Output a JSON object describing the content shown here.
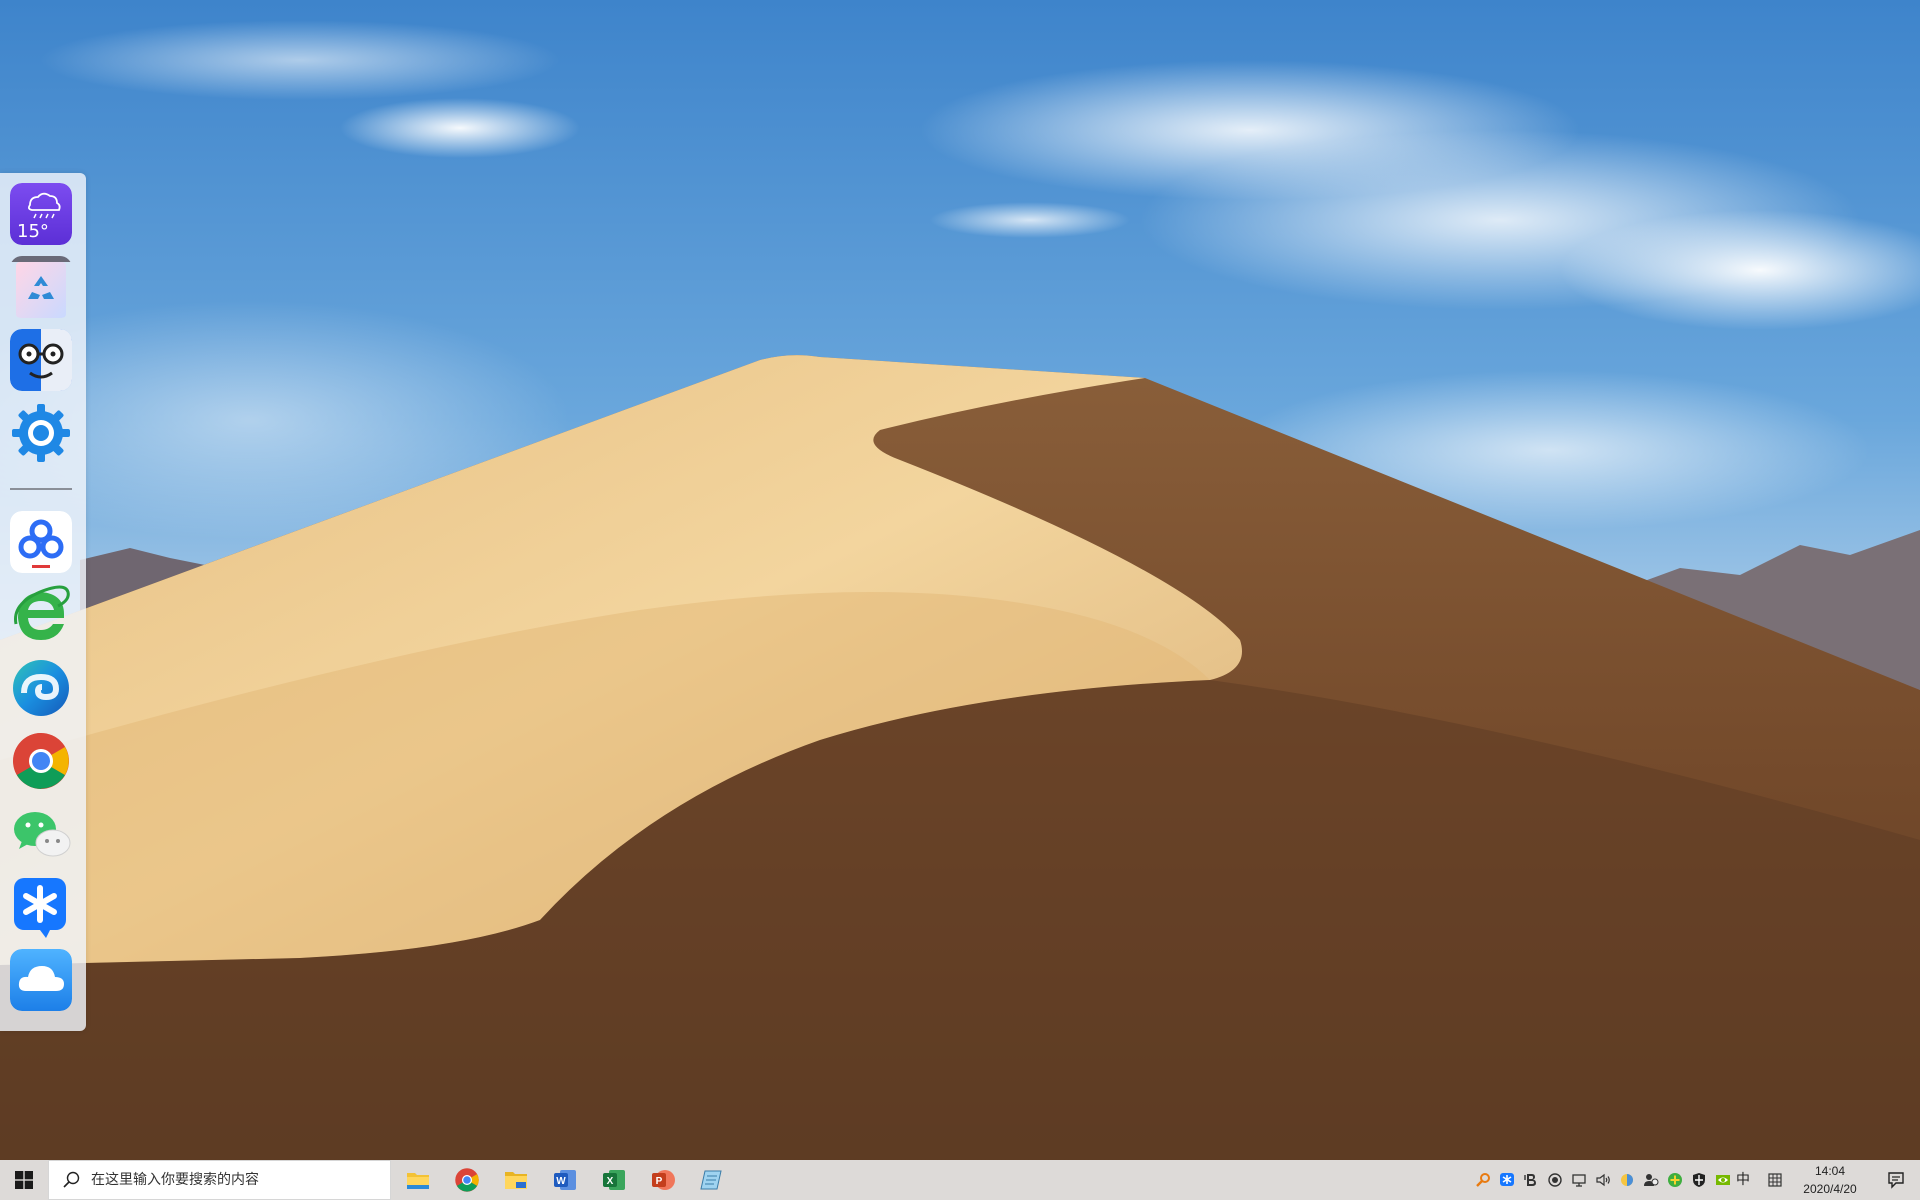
{
  "dock": {
    "weather": {
      "temperature": "15°",
      "icon": "rain-cloud-icon"
    },
    "items": [
      {
        "name": "weather-widget",
        "icon": "rain-cloud-icon"
      },
      {
        "name": "recycle-bin",
        "icon": "recycle-icon"
      },
      {
        "name": "finder",
        "icon": "glasses-face-icon"
      },
      {
        "name": "settings",
        "icon": "gear-icon"
      },
      {
        "name": "baidu-netdisk",
        "icon": "baidu-netdisk-icon"
      },
      {
        "name": "360-browser",
        "icon": "ie-e-icon"
      },
      {
        "name": "edge",
        "icon": "edge-icon"
      },
      {
        "name": "chrome",
        "icon": "chrome-icon"
      },
      {
        "name": "wechat",
        "icon": "wechat-icon"
      },
      {
        "name": "dingtalk",
        "icon": "asterisk-bubble-icon"
      },
      {
        "name": "cloud-drive",
        "icon": "cloud-icon"
      }
    ]
  },
  "taskbar": {
    "search": {
      "placeholder": "在这里输入你要搜索的内容"
    },
    "apps": [
      {
        "name": "file-explorer",
        "icon": "folder-icon"
      },
      {
        "name": "chrome",
        "icon": "chrome-icon"
      },
      {
        "name": "file-explorer-2",
        "icon": "folder-alt-icon"
      },
      {
        "name": "word",
        "icon": "word-icon",
        "letter": "W"
      },
      {
        "name": "excel",
        "icon": "excel-icon",
        "letter": "X"
      },
      {
        "name": "powerpoint",
        "icon": "powerpoint-icon",
        "letter": "P"
      },
      {
        "name": "notepad",
        "icon": "notepad-icon"
      }
    ],
    "tray": {
      "ime": "中",
      "time": "14:04",
      "date": "2020/4/20"
    }
  },
  "colors": {
    "sky_top": "#3f86cc",
    "sand_light": "#f1cf92",
    "sand_dark": "#6e4527",
    "accent_blue": "#1677ff"
  }
}
